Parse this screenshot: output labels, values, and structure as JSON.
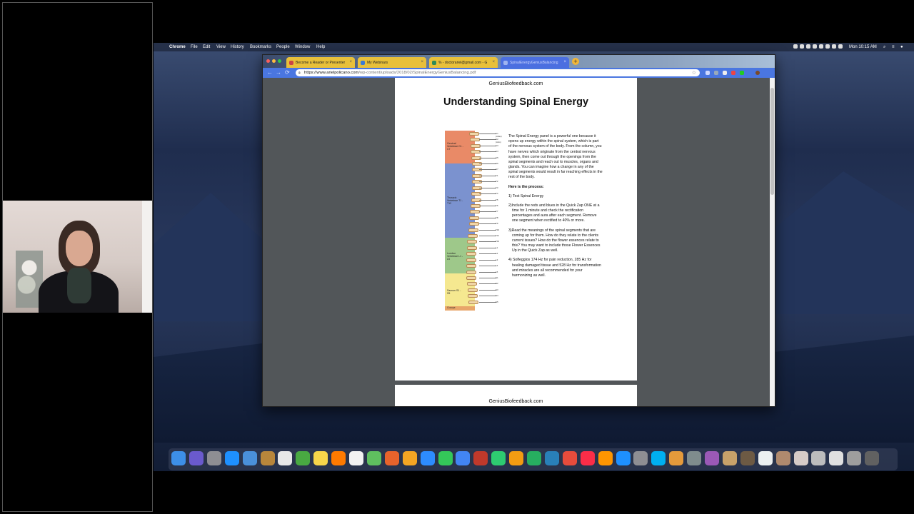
{
  "menubar": {
    "apple": "",
    "app_name": "Chrome",
    "menus": [
      "File",
      "Edit",
      "View",
      "History",
      "Bookmarks",
      "People",
      "Window",
      "Help"
    ],
    "clock": "Mon 10:15 AM"
  },
  "browser": {
    "tabs": [
      {
        "label": "Become a Reader or Presenter",
        "active": false
      },
      {
        "label": "My Webinars",
        "active": false
      },
      {
        "label": "% - doctorariel@gmail.com - G",
        "active": false
      },
      {
        "label": "SpinalEnergyGeniusBalancing",
        "active": true
      }
    ],
    "new_tab": "+",
    "nav": {
      "back": "←",
      "forward": "→",
      "reload": "⟳"
    },
    "url_host": "https://www.arielpolicano.com",
    "url_path": "/wp-content/uploads/2018/02/SpinalEnergyGeniusBalancing.pdf",
    "star": "☆"
  },
  "pdf": {
    "header": "GeniusBiofeedback.com",
    "title": "Understanding Spinal Energy",
    "figure": {
      "regions": [
        {
          "label": "Cervical Vertebrae C1 - C7",
          "color": "#e98a67"
        },
        {
          "label": "Thoracic Vertebrae T1 - T12",
          "color": "#7b92cf"
        },
        {
          "label": "Lumbar Vertebrae L1 - L5",
          "color": "#9ec88a"
        },
        {
          "label": "Sacrum S1 - S5",
          "color": "#f5e890"
        },
        {
          "label": "Coccyx",
          "color": "#e8a66a"
        }
      ],
      "segments": [
        "C1 (Atlas)",
        "C2 (Axis)",
        "C3",
        "C4",
        "C5",
        "C6",
        "C7",
        "T1",
        "T2",
        "T3",
        "T4",
        "T5",
        "T6",
        "T7",
        "T8",
        "T9",
        "T10",
        "T11",
        "T12",
        "L1",
        "L2",
        "L3",
        "L4",
        "L5",
        "S1",
        "S2",
        "S3",
        "S4",
        "S5"
      ]
    },
    "intro": "The Spinal Energy panel is a powerful one because it opens up energy within the spinal system, which is part of the nervous system of the body. From the column, you have nerves which originate from the central nervous system, then come out through the openings from the spinal segments and reach out to muscles, organs and glands. You can imagine how a change in any of the spinal segments would result in far reaching effects in the rest of the body.",
    "process_heading": "Here is the process:",
    "steps": [
      "1) Test Spinal Energy",
      "2)Include the reds and blues in the Quick Zap ONE at a time for 1 minute and check the rectification percentages and aura after each segment. Remove one segment when rectified to 40% or more.",
      "3)Read the meanings of the spinal segments that are coming up for them. How do they relate to the clients current issues? How do the flower essences relate to this? You may want to include those Flower Essences Up in the Quick Zap as well.",
      "4) Solfeggios 174 Hz for pain reduction, 285 Hz for healing damaged tissue and 528 Hz for transformation and miracles are all recommended for your harmonizing as well."
    ],
    "page2_header": "GeniusBiofeedback.com"
  },
  "dock": {
    "icons": [
      "finder-icon",
      "siri-icon",
      "launchpad-icon",
      "safari-icon",
      "preview-icon",
      "contacts-icon",
      "calendar-icon",
      "evernote-icon",
      "notes-icon",
      "firefox-icon",
      "reminders-icon",
      "maps-icon",
      "photo-editor-icon",
      "photos-icon",
      "zoom-icon",
      "messages-icon",
      "chrome-icon",
      "photo-booth-icon",
      "facetime-icon",
      "pages-icon",
      "numbers-icon",
      "keynote-icon",
      "news-icon",
      "music-icon",
      "books-icon",
      "app-store-icon",
      "system-preferences-icon",
      "skype-icon",
      "genius-icon",
      "storage-icon",
      "colorsync-icon",
      "doc1-icon",
      "doc2-icon",
      "doc3-icon",
      "doc4-icon",
      "doc5-icon",
      "doc6-icon",
      "doc7-icon",
      "doc8-icon",
      "trash-icon"
    ]
  },
  "colors": {
    "chrome_toolbar": "#4a76e0",
    "tab_inactive": "#e8c03a",
    "tab_active": "#4b6fe0",
    "pdf_background": "#525659"
  }
}
